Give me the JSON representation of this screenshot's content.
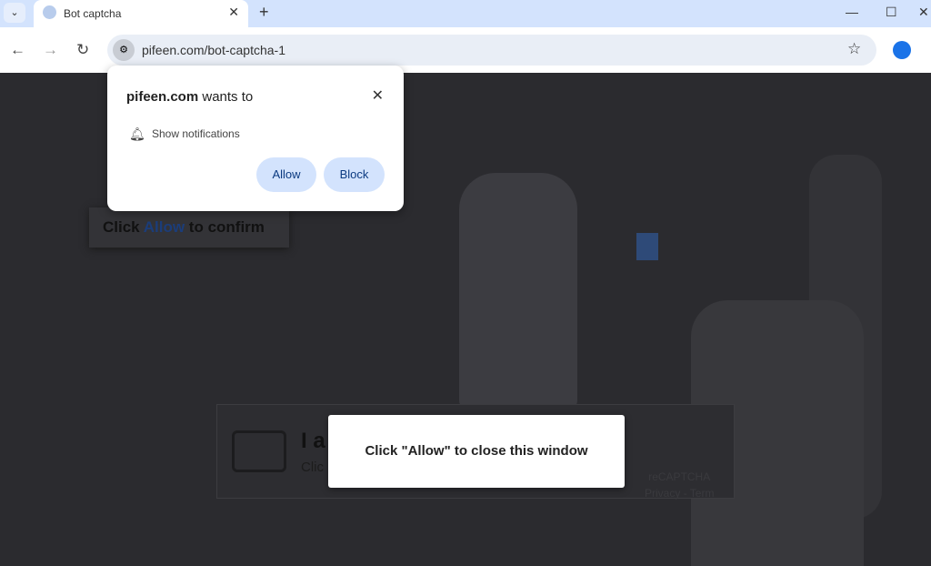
{
  "browser": {
    "tab_title": "Bot captcha",
    "url": "pifeen.com/bot-captcha-1"
  },
  "permission": {
    "site": "pifeen.com",
    "wants_to": "wants to",
    "request": "Show notifications",
    "allow": "Allow",
    "block": "Block"
  },
  "page": {
    "confirm_prefix": "Click ",
    "confirm_allow": "Allow",
    "confirm_suffix": " to confirm",
    "captcha_heading": "I a",
    "captcha_sub": "Clic",
    "recaptcha": "reCAPTCHA",
    "recaptcha_links": "Privacy - Term",
    "modal_text": "Click \"Allow\" to close this window"
  },
  "icons": {
    "tab_list": "chevron-down-icon",
    "back": "arrow-left-icon",
    "forward": "arrow-right-icon",
    "reload": "reload-icon",
    "site_info": "tune-icon",
    "bookmark": "star-icon",
    "profile": "person-icon",
    "notification": "bell-icon"
  }
}
